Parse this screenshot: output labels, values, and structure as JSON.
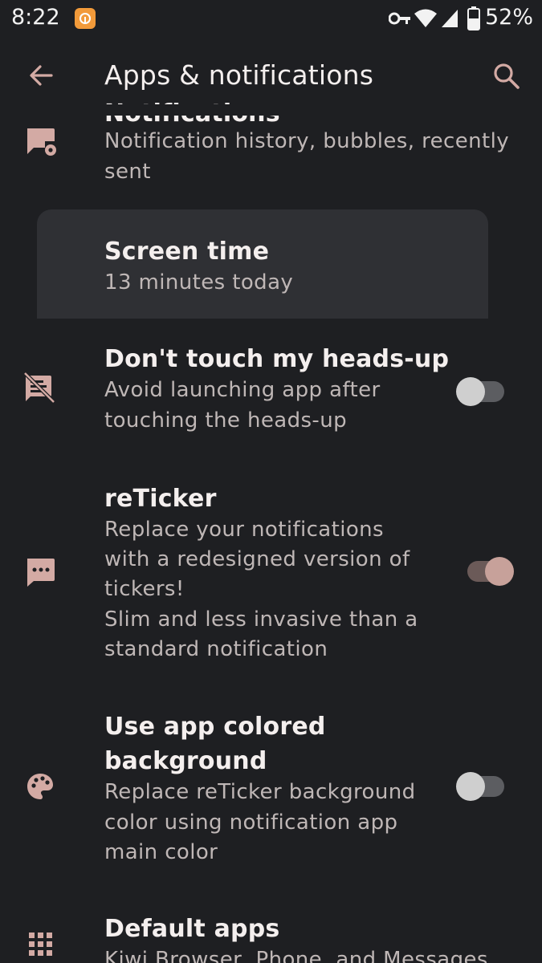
{
  "status_bar": {
    "time": "8:22",
    "battery_percent": "52%",
    "icons": [
      "notification-app-icon",
      "vpn-key-icon",
      "wifi-icon",
      "signal-icon",
      "battery-icon"
    ]
  },
  "app_bar": {
    "title": "Apps & notifications",
    "back_icon": "arrow-back-icon",
    "search_icon": "search-icon"
  },
  "settings": {
    "notifications": {
      "title": "Notifications",
      "summary_line1": "Notification history, bubbles, recently",
      "summary_line2": "sent",
      "icon": "notification-settings-icon"
    },
    "screen_time": {
      "title": "Screen time",
      "summary": "13 minutes today"
    },
    "heads_up": {
      "title": "Don't touch my heads-up",
      "summary_line1": "Avoid launching app after",
      "summary_line2": "touching the heads-up",
      "icon": "comment-off-icon",
      "enabled": false
    },
    "reticker": {
      "title": "reTicker",
      "summary_line1": "Replace your notifications",
      "summary_line2": "with a redesigned version of",
      "summary_line3": "tickers!",
      "summary_line4": "Slim and less invasive than a",
      "summary_line5": "standard notification",
      "icon": "chat-dots-icon",
      "enabled": true
    },
    "colored_bg": {
      "title_line1": "Use app colored",
      "title_line2": "background",
      "summary_line1": "Replace reTicker background",
      "summary_line2": "color using notification app",
      "summary_line3": "main color",
      "icon": "palette-icon",
      "enabled": false
    },
    "default_apps": {
      "title": "Default apps",
      "summary": "Kiwi Browser, Phone, and Messages",
      "icon": "apps-grid-icon"
    }
  },
  "colors": {
    "background": "#1e1f22",
    "highlight": "#2f3034",
    "accent": "#c7a19a",
    "icon_tint": "#d3aaa4"
  }
}
